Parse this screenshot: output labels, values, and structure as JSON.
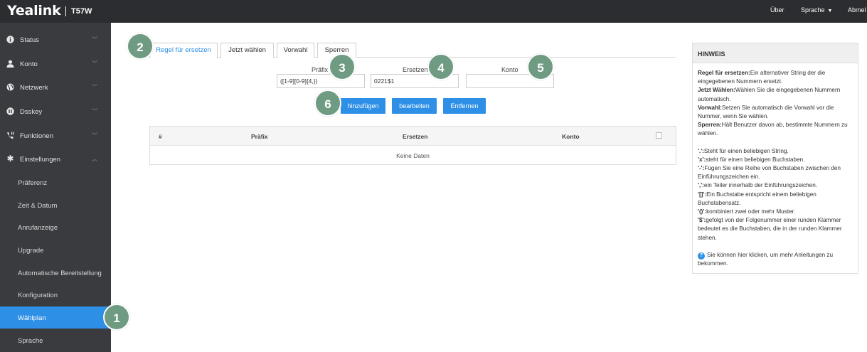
{
  "header": {
    "brand": "Yealink",
    "model": "T57W",
    "links": {
      "about": "Über",
      "language": "Sprache",
      "logout": "Abmel"
    }
  },
  "sidebar": {
    "items": [
      {
        "label": "Status",
        "icon": "info-icon"
      },
      {
        "label": "Konto",
        "icon": "user-icon"
      },
      {
        "label": "Netzwerk",
        "icon": "globe-icon"
      },
      {
        "label": "Dsskey",
        "icon": "keypad-icon"
      },
      {
        "label": "Funktionen",
        "icon": "phone-settings-icon"
      },
      {
        "label": "Einstellungen",
        "icon": "gear-icon"
      }
    ],
    "subitems": [
      "Präferenz",
      "Zeit & Datum",
      "Anrufanzeige",
      "Upgrade",
      "Automatische Bereitstellung",
      "Konfiguration",
      "Wählplan",
      "Sprache"
    ],
    "active": "Wählplan"
  },
  "tabs": [
    "Regel für ersetzen",
    "Jetzt wählen",
    "Vorwahl",
    "Sperren"
  ],
  "form": {
    "prefix_label": "Präfix",
    "prefix_value": "([1-9][0-9]{4,})",
    "replace_label": "Ersetzen",
    "replace_value": "0221$1",
    "account_label": "Konto",
    "account_value": ""
  },
  "buttons": {
    "add": "hinzufügen",
    "edit": "bearbeiten",
    "remove": "Entfernen"
  },
  "table": {
    "columns": [
      "#",
      "Präfix",
      "Ersetzen",
      "Konto"
    ],
    "empty": "Keine Daten"
  },
  "hint": {
    "title": "HINWEIS",
    "items": [
      {
        "term": "Regel für ersetzen:",
        "text": "Ein alternativer String der die eingegebenen Nummern ersetzt."
      },
      {
        "term": "Jetzt Wählen:",
        "text": "Wählen Sie die eingegebenen Nummern automatisch."
      },
      {
        "term": "Vorwahl:",
        "text": "Setzen Sie automatisch die Vorwahl vor die Nummer, wenn Sie wählen."
      },
      {
        "term": "Sperren:",
        "text": "Hält Benutzer davon ab, bestimmte Nummern zu wählen."
      }
    ],
    "symbols": [
      {
        "term": "'.':",
        "text": "Steht für einen beliebigen String."
      },
      {
        "term": "'x':",
        "text": "steht für einen beliebigen Buchstaben."
      },
      {
        "term": "'-':",
        "text": "Fügen Sie eine Reihe von Buchstaben zwischen den Einführungszeichen ein."
      },
      {
        "term": "',':",
        "text": "ein Teiler innerhalb der Einführungszeichen."
      },
      {
        "term": "'[]':",
        "text": "Ein Buchstabe entspricht einem beliebigen Buchstabensatz."
      },
      {
        "term": "'()':",
        "text": "kombiniert zwei oder mehr Muster."
      },
      {
        "term": "'$':",
        "text": "gefolgt von der Folgenummer einer runden Klammer bedeutet es die Buchstaben, die in der runden Klammer stehen."
      }
    ],
    "help": "Sie können hier klicken, um mehr Anleitungen zu bekommen."
  },
  "annotations": [
    "1",
    "2",
    "3",
    "4",
    "5",
    "6"
  ],
  "colors": {
    "accent": "#2d8fe6",
    "sidebar": "#3a3b3f",
    "topbar": "#2c2d30",
    "badge": "#6f9b83"
  }
}
